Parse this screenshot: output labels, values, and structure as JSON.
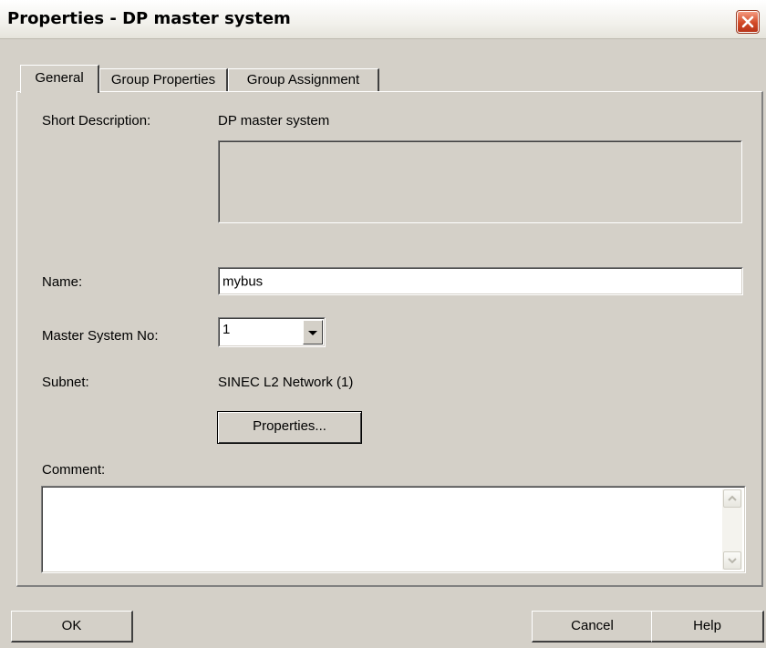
{
  "window": {
    "title": "Properties - DP master system",
    "close_icon": "close-icon"
  },
  "tabs": [
    {
      "label": "General",
      "active": true
    },
    {
      "label": "Group Properties",
      "active": false
    },
    {
      "label": "Group Assignment",
      "active": false
    }
  ],
  "general": {
    "short_description_label": "Short Description:",
    "short_description_value": "DP master system",
    "description_text": "",
    "name_label": "Name:",
    "name_value": "mybus",
    "master_system_label": "Master System No:",
    "master_system_value": "1",
    "subnet_label": "Subnet:",
    "subnet_value": "SINEC L2 Network (1)",
    "subnet_properties_button": "Properties...",
    "comment_label": "Comment:",
    "comment_value": ""
  },
  "footer": {
    "ok_label": "OK",
    "cancel_label": "Cancel",
    "help_label": "Help"
  },
  "colors": {
    "dialog_background": "#d4d0c8",
    "close_button": "#d24a27"
  }
}
